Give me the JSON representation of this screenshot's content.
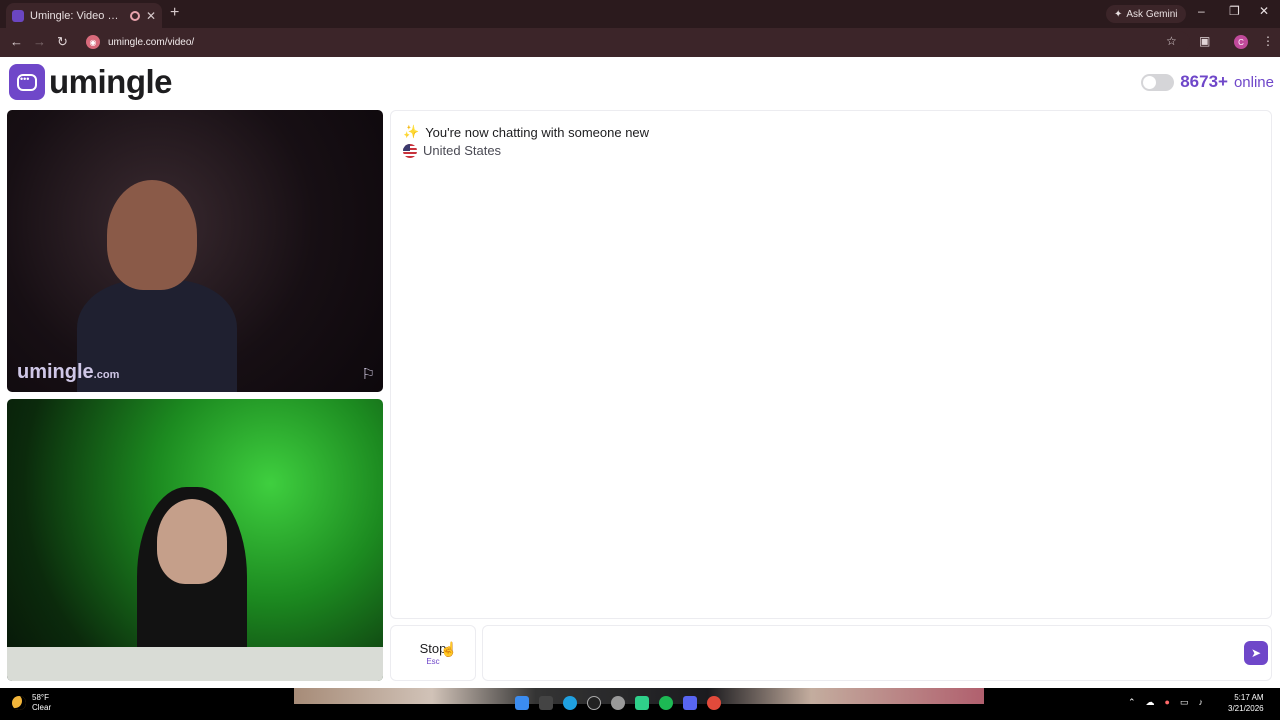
{
  "browser": {
    "tab_title": "Umingle: Video Chat with S",
    "new_tab_symbol": "+",
    "ask_gemini": "Ask Gemini",
    "address": "umingle.com/video/",
    "profile_initial": "C"
  },
  "header": {
    "logo_text": "umingle",
    "online_count": "8673+",
    "online_label": "online"
  },
  "video": {
    "watermark_main": "umingle",
    "watermark_suffix": ".com"
  },
  "chat": {
    "system_message": "You're now chatting with someone new",
    "country": "United States",
    "input_placeholder": ""
  },
  "controls": {
    "stop_label": "Stop",
    "stop_key": "Esc"
  },
  "taskbar": {
    "temperature": "58°F",
    "condition": "Clear",
    "time": "5:17 AM",
    "date": "3/21/2026"
  },
  "colors": {
    "brand": "#6f47c9",
    "chrome_bg": "#2b1a1d"
  }
}
